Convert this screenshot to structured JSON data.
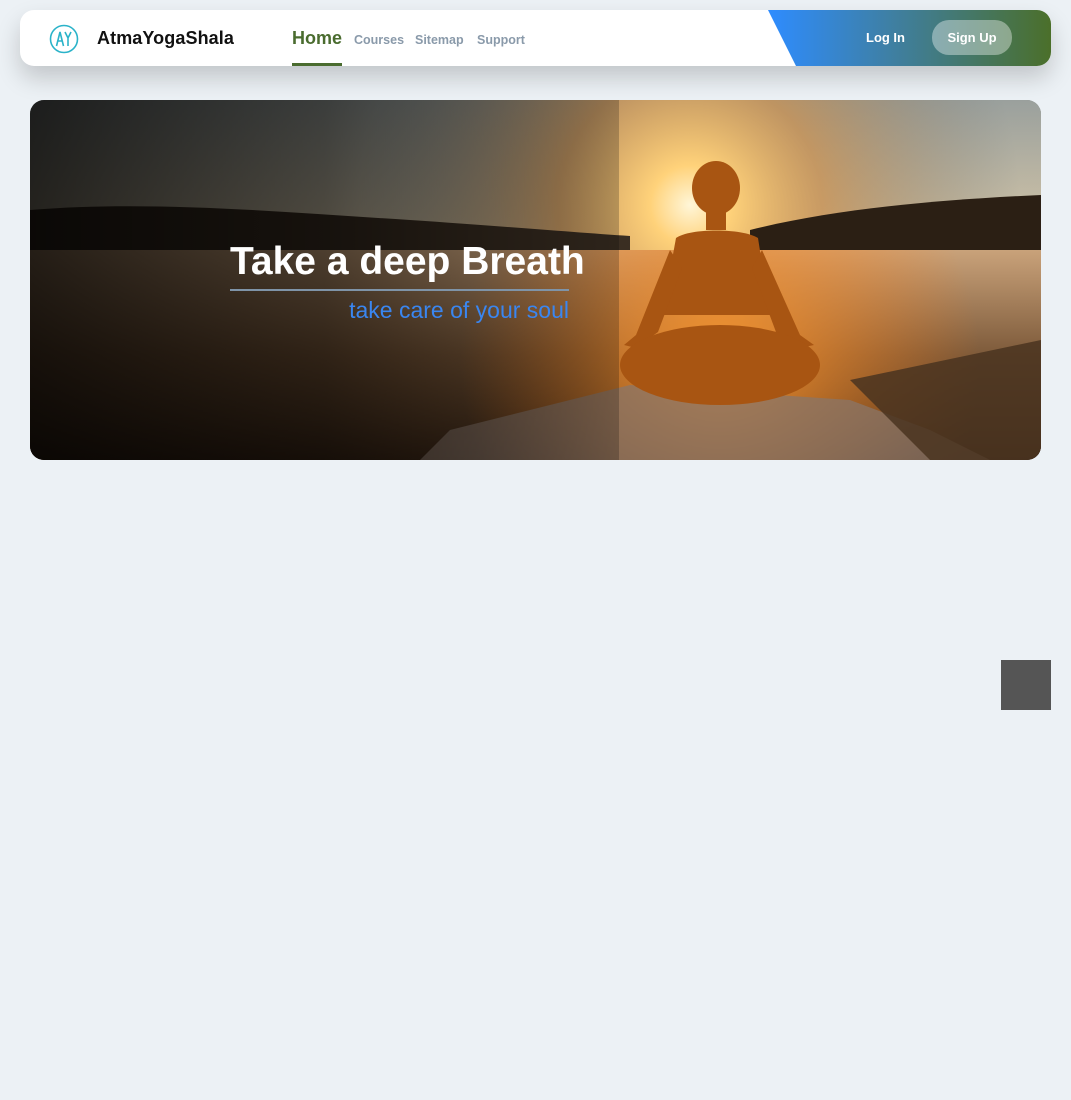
{
  "brand": {
    "name": "AtmaYogaShala",
    "logo_icon": "ay-monogram-icon"
  },
  "nav": {
    "home": "Home",
    "courses": "Courses",
    "sitemap": "Sitemap",
    "support": "Support"
  },
  "auth": {
    "login": "Log In",
    "signup": "Sign Up"
  },
  "hero": {
    "title": "Take a deep Breath",
    "subtitle": "take care of your soul"
  },
  "colors": {
    "accent_green": "#4a6c2f",
    "accent_blue": "#3a86f0",
    "background": "#ecf1f5",
    "logo_teal": "#2bb3c9"
  }
}
